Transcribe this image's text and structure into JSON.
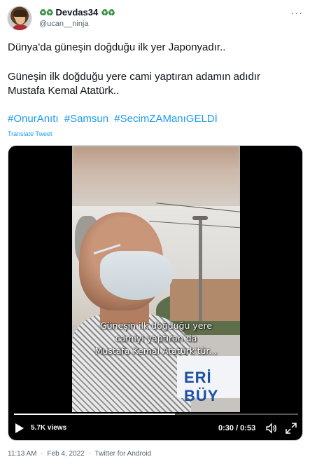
{
  "user": {
    "display_name": "Devdas34",
    "name_emoji": "♻♻",
    "handle": "@ucan__ninja"
  },
  "tweet": {
    "line1": "Dünya'da güneşin doğduğu ilk yer Japonyadır..",
    "line2": "Güneşin ilk doğduğu yere cami yaptıran adamın adıdır",
    "line3": "Mustafa Kemal Atatürk..",
    "hashtags": [
      "#OnurAnıtı",
      "#Samsun",
      "#SecimZAManıGELDİ"
    ],
    "translate_label": "Translate Tweet"
  },
  "video": {
    "subtitle_lines": [
      "Güneşin ilk doğduğu yere",
      "camiyi yaptıran da",
      "Mustafa Kemal Atatürk'tür..."
    ],
    "banner_text": "ERİ BÜY",
    "views": "5.7K views",
    "time": "0:30 / 0:53",
    "progress": 0.566,
    "play_icon": "play-icon",
    "volume_icon": "volume-icon",
    "expand_icon": "fullscreen-icon"
  },
  "meta": {
    "time": "11:13 AM",
    "date": "Feb 4, 2022",
    "source": "Twitter for Android",
    "separator": "·"
  },
  "colors": {
    "link": "#1d9bf0",
    "muted": "#536471"
  }
}
